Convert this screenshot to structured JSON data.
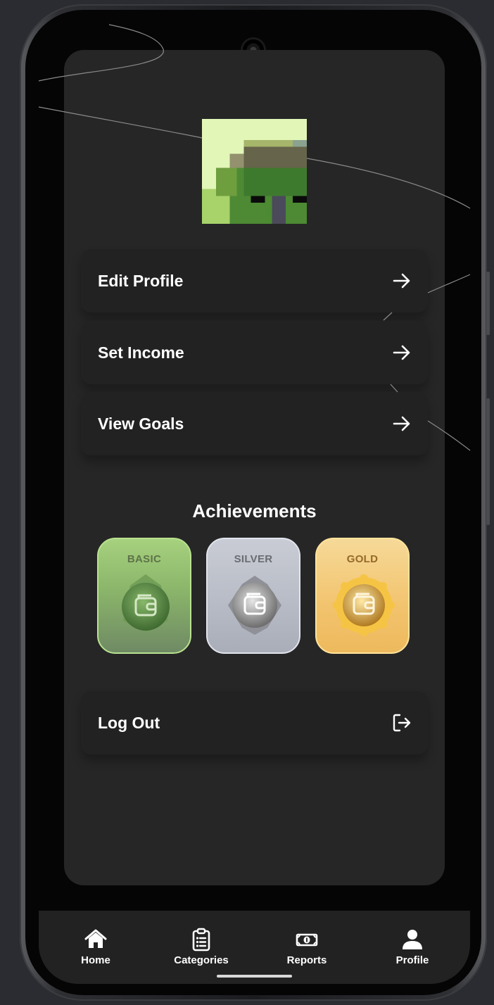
{
  "menu": {
    "edit_profile": "Edit Profile",
    "set_income": "Set Income",
    "view_goals": "View Goals",
    "log_out": "Log Out"
  },
  "achievements": {
    "title": "Achievements",
    "badges": [
      {
        "label": "BASIC",
        "icon": "wallet-icon",
        "color": "#8fb86a"
      },
      {
        "label": "SILVER",
        "icon": "wallet-icon",
        "color": "#b8bcc6"
      },
      {
        "label": "GOLD",
        "icon": "wallet-icon",
        "color": "#f2c36d"
      }
    ]
  },
  "nav": {
    "items": [
      {
        "label": "Home",
        "icon": "home-icon"
      },
      {
        "label": "Categories",
        "icon": "clipboard-list-icon"
      },
      {
        "label": "Reports",
        "icon": "money-icon"
      },
      {
        "label": "Profile",
        "icon": "user-icon"
      }
    ]
  },
  "avatar": {
    "icon": "pixel-avatar-icon"
  }
}
